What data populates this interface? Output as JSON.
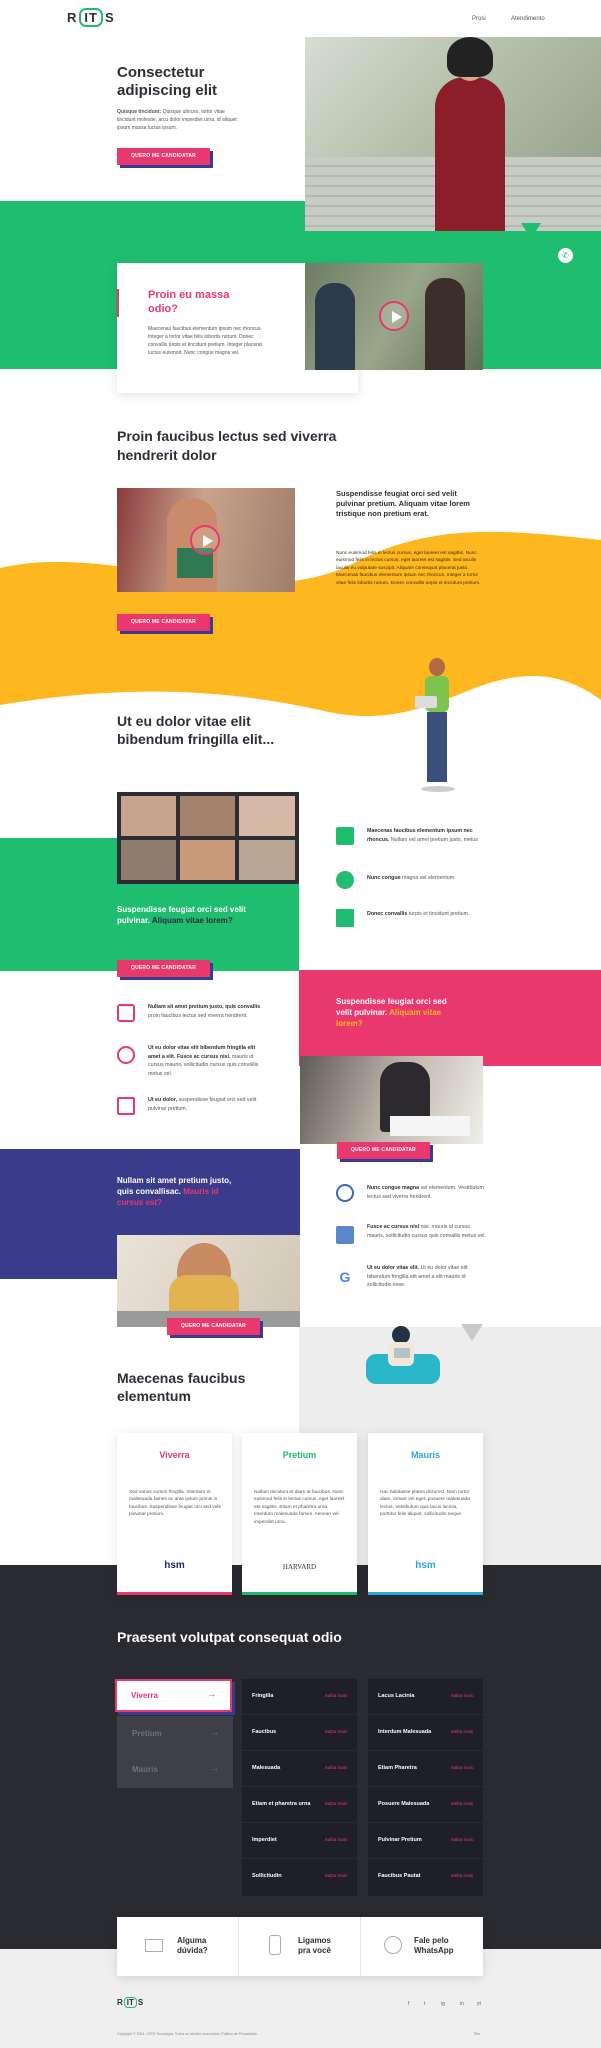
{
  "header": {
    "logo_left": "R",
    "logo_mid": "IT",
    "logo_right": "S",
    "nav": [
      "Prosi",
      "Atendimento"
    ]
  },
  "hero": {
    "title": "Consectetur adipiscing elit",
    "text_bold": "Quisque tincidunt:",
    "text": "Quisque ultrices, tortor vitae tincidunt molestie, arcu dolor imperdiet urna, id aliquet ipsum massa luctus ipsum.",
    "cta": "QUERO ME CANDIDATAR"
  },
  "video1": {
    "title": "Proin eu massa odio?",
    "text": "Maecenas faucibus elementum ipsum nec rhoncus. Integer a tortor vitae felis lobortis rutrum. Donec convallis turpis et tincidunt pretium. Integer placerat luctus euismod. Nunc congue magna vel."
  },
  "section2": {
    "title": "Proin faucibus lectus sed viverra hendrerit dolor",
    "subtitle": "Suspendisse feugiat orci sed velit pulvinar pretium. Aliquam vitae lorem tristique non pretium erat.",
    "body": "Nunc euismod felis in lectus cursus, eget laoreet est sagittis. Nunc euismod felis in lectus cursus, eget laoreet est sagittis. Sed iaculis iaculis eu vulputate suscipit. Aliquam consequat placerat justo. Maecenas faucibus elementum ipsum nec rhoncus. Integer a tortor vitae felis lobortis rutrum. Donec convallis turpis et tincidunt pretium.",
    "cta": "QUERO ME CANDIDATAR"
  },
  "section3": {
    "title": "Ut eu dolor vitae elit bibendum fringilla elit...",
    "green_text": "Suspendisse feugiat orci sed velit pulvinar.",
    "green_accent": "Aliquam vitae lorem?",
    "cta": "QUERO ME CANDIDATAR",
    "features": [
      {
        "bold": "Maecenas faucibus elementum ipsum nec rhoncus.",
        "text": "Nullam vel amet pretium justo, metus"
      },
      {
        "bold": "Nunc congue",
        "text": "magna vel elementum"
      },
      {
        "bold": "Donec convallis",
        "text": "turpis et tincidunt pretium."
      }
    ]
  },
  "section4": {
    "features": [
      {
        "bold": "Nullam sit amet pretium justo, quis convallis",
        "text": "proin faucibus lectus sed viverra hendrerit."
      },
      {
        "bold": "Ut eu dolor vitae elit bibendum fringilla elit amet a elit. Fusce ac cursus nisl.",
        "text": "mauris id cursus mauris, sollicitudin cursus quis convallis metus vel."
      },
      {
        "bold": "Ut eu dolor,",
        "text": "suspendisse feugiat orci sed velit pulvinar pretium."
      }
    ],
    "pink_text": "Suspendisse feugiat orci sed velit pulvinar.",
    "pink_accent": "Aliquam vitae lorem?",
    "cta": "QUERO ME CANDIDATAR"
  },
  "section5": {
    "blue_text": "Nullam sit amet pretium justo, quis convallisac.",
    "blue_accent": "Mauris id cursus est?",
    "cta": "QUERO ME CANDIDATAR",
    "features": [
      {
        "bold": "Nunc congue magna",
        "text": "vel elementum. Vestibulum lectus sed viverra hendrerit."
      },
      {
        "bold": "Fusce ac cursus nisl",
        "text": "nisi. mauris id cursus mauris, sollicitudin cursus quis convallis metus vel."
      },
      {
        "bold": "Ut eu dolor vitae elit.",
        "text": "Ut eu dolor vitae elit bibendum fringilla elit amet a elit mauris id sollicitudin esse."
      }
    ]
  },
  "section6": {
    "title": "Maecenas faucibus elementum",
    "cards": [
      {
        "name": "Viverra",
        "color": "#e8386e",
        "text": "Sed varius cursus fringilla. Interdum et malesuada fames ac ante ipsum primis in faucibus. Suspendisse feugiat orci sed velit pulvinar pretium.",
        "logo": "hsm"
      },
      {
        "name": "Pretium",
        "color": "#1fb96a",
        "text": "Nullam tincidunt et diam at faucibus. Nunc euismod felis in lectus cursus, eget laoreet est sagittis. Etiam et pharetra urna. Interdum malesuada fames. Aenean vel imperdiet urna.",
        "logo": "HARVARD"
      },
      {
        "name": "Mauris",
        "color": "#2ba7d8",
        "text": "Hac habitasse platea dictumst. Nam tortor diam, ornare vel eget, posuere malesuada lectus. Vestibulum quis lacus lacinia, porttitor felis aliquet, sollicitudin neque.",
        "logo": "hsm"
      }
    ]
  },
  "section7": {
    "title": "Praesent volutpat consequat odio",
    "tabs": [
      "Viverra",
      "Pretium",
      "Mauris"
    ],
    "col1": [
      "Fringilla",
      "Faucibus",
      "Malesuada",
      "Etiam et pharetra urna",
      "Imperdiet",
      "Sollicitudin"
    ],
    "col2": [
      "Lacus Lacinia",
      "Interdum Malesuada",
      "Etiam Pharetra",
      "Posuere Malesuada",
      "Pulvinar Pretium",
      "Faucibus Pautat"
    ],
    "more": "Saiba mais"
  },
  "contact": [
    {
      "label": "Alguma dúvida?"
    },
    {
      "label": "Ligamos pra você"
    },
    {
      "label": "Fale pelo WhatsApp"
    }
  ],
  "footer": {
    "copyright": "Copyright © 2024 - RITS Tecnologia. Todos os direitos reservados. Política de Privacidade.",
    "right": "Rits",
    "social": [
      "f",
      "t",
      "ig",
      "in",
      "yt"
    ]
  },
  "colors": {
    "green": "#1fbd6f",
    "pink": "#e8386e",
    "yellow": "#ffb71f",
    "navy": "#3a3b8a",
    "dark": "#2a2b31"
  }
}
